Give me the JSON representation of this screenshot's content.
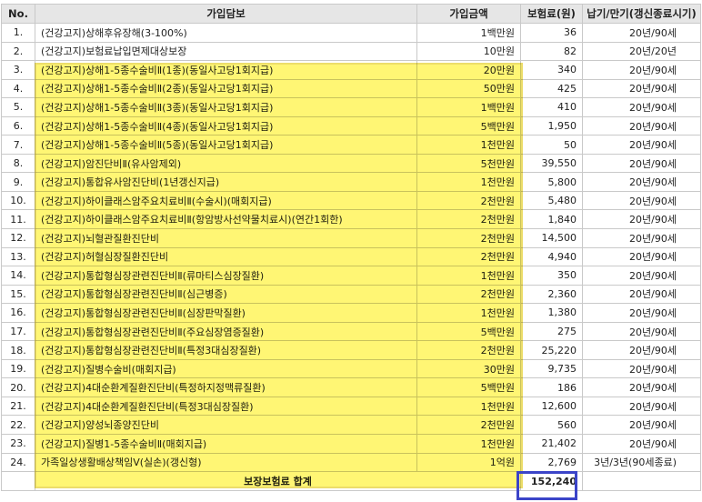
{
  "headers": {
    "no": "No.",
    "coverage": "가입담보",
    "amount": "가입금액",
    "premium": "보험료(원)",
    "term": "납기/만기(갱신종료시기)"
  },
  "rows": [
    {
      "no": "1.",
      "coverage": "(건강고지)상해후유장해(3-100%)",
      "amount": "1백만원",
      "premium": "36",
      "term": "20년/90세"
    },
    {
      "no": "2.",
      "coverage": "(건강고지)보험료납입면제대상보장",
      "amount": "10만원",
      "premium": "82",
      "term": "20년/20년"
    },
    {
      "no": "3.",
      "coverage": "(건강고지)상해1-5종수술비Ⅱ(1종)(동일사고당1회지급)",
      "amount": "20만원",
      "premium": "340",
      "term": "20년/90세"
    },
    {
      "no": "4.",
      "coverage": "(건강고지)상해1-5종수술비Ⅱ(2종)(동일사고당1회지급)",
      "amount": "50만원",
      "premium": "425",
      "term": "20년/90세"
    },
    {
      "no": "5.",
      "coverage": "(건강고지)상해1-5종수술비Ⅱ(3종)(동일사고당1회지급)",
      "amount": "1백만원",
      "premium": "410",
      "term": "20년/90세"
    },
    {
      "no": "6.",
      "coverage": "(건강고지)상해1-5종수술비Ⅱ(4종)(동일사고당1회지급)",
      "amount": "5백만원",
      "premium": "1,950",
      "term": "20년/90세"
    },
    {
      "no": "7.",
      "coverage": "(건강고지)상해1-5종수술비Ⅱ(5종)(동일사고당1회지급)",
      "amount": "1천만원",
      "premium": "50",
      "term": "20년/90세"
    },
    {
      "no": "8.",
      "coverage": "(건강고지)암진단비Ⅱ(유사암제외)",
      "amount": "5천만원",
      "premium": "39,550",
      "term": "20년/90세"
    },
    {
      "no": "9.",
      "coverage": "(건강고지)통합유사암진단비(1년갱신지급)",
      "amount": "1천만원",
      "premium": "5,800",
      "term": "20년/90세"
    },
    {
      "no": "10.",
      "coverage": "(건강고지)하이클래스암주요치료비Ⅱ(수술시)(매회지급)",
      "amount": "2천만원",
      "premium": "5,480",
      "term": "20년/90세"
    },
    {
      "no": "11.",
      "coverage": "(건강고지)하이클래스암주요치료비Ⅱ(항암방사선약물치료시)(연간1회한)",
      "amount": "2천만원",
      "premium": "1,840",
      "term": "20년/90세"
    },
    {
      "no": "12.",
      "coverage": "(건강고지)뇌혈관질환진단비",
      "amount": "2천만원",
      "premium": "14,500",
      "term": "20년/90세"
    },
    {
      "no": "13.",
      "coverage": "(건강고지)허혈심장질환진단비",
      "amount": "2천만원",
      "premium": "4,940",
      "term": "20년/90세"
    },
    {
      "no": "14.",
      "coverage": "(건강고지)통합형심장관련진단비Ⅱ(류마티스심장질환)",
      "amount": "1천만원",
      "premium": "350",
      "term": "20년/90세"
    },
    {
      "no": "15.",
      "coverage": "(건강고지)통합형심장관련진단비Ⅱ(심근병증)",
      "amount": "2천만원",
      "premium": "2,360",
      "term": "20년/90세"
    },
    {
      "no": "16.",
      "coverage": "(건강고지)통합형심장관련진단비Ⅱ(심장판막질환)",
      "amount": "1천만원",
      "premium": "1,380",
      "term": "20년/90세"
    },
    {
      "no": "17.",
      "coverage": "(건강고지)통합형심장관련진단비Ⅱ(주요심장염증질환)",
      "amount": "5백만원",
      "premium": "275",
      "term": "20년/90세"
    },
    {
      "no": "18.",
      "coverage": "(건강고지)통합형심장관련진단비Ⅱ(특정3대심장질환)",
      "amount": "2천만원",
      "premium": "25,220",
      "term": "20년/90세"
    },
    {
      "no": "19.",
      "coverage": "(건강고지)질병수술비(매회지급)",
      "amount": "30만원",
      "premium": "9,735",
      "term": "20년/90세"
    },
    {
      "no": "20.",
      "coverage": "(건강고지)4대순환계질환진단비(특정하지정맥류질환)",
      "amount": "5백만원",
      "premium": "186",
      "term": "20년/90세"
    },
    {
      "no": "21.",
      "coverage": "(건강고지)4대순환계질환진단비(특정3대심장질환)",
      "amount": "1천만원",
      "premium": "12,600",
      "term": "20년/90세"
    },
    {
      "no": "22.",
      "coverage": "(건강고지)양성뇌종양진단비",
      "amount": "2천만원",
      "premium": "560",
      "term": "20년/90세"
    },
    {
      "no": "23.",
      "coverage": "(건강고지)질병1-5종수술비Ⅱ(매회지급)",
      "amount": "1천만원",
      "premium": "21,402",
      "term": "20년/90세"
    },
    {
      "no": "24.",
      "coverage": "가족일상생활배상책임Ⅴ(실손)(갱신형)",
      "amount": "1억원",
      "premium": "2,769",
      "term": "3년/3년(90세종료)"
    }
  ],
  "total": {
    "label": "보장보험료 합계",
    "value": "152,240"
  },
  "highlight_color": "#fff01e",
  "total_box_color": "#3b44c8"
}
